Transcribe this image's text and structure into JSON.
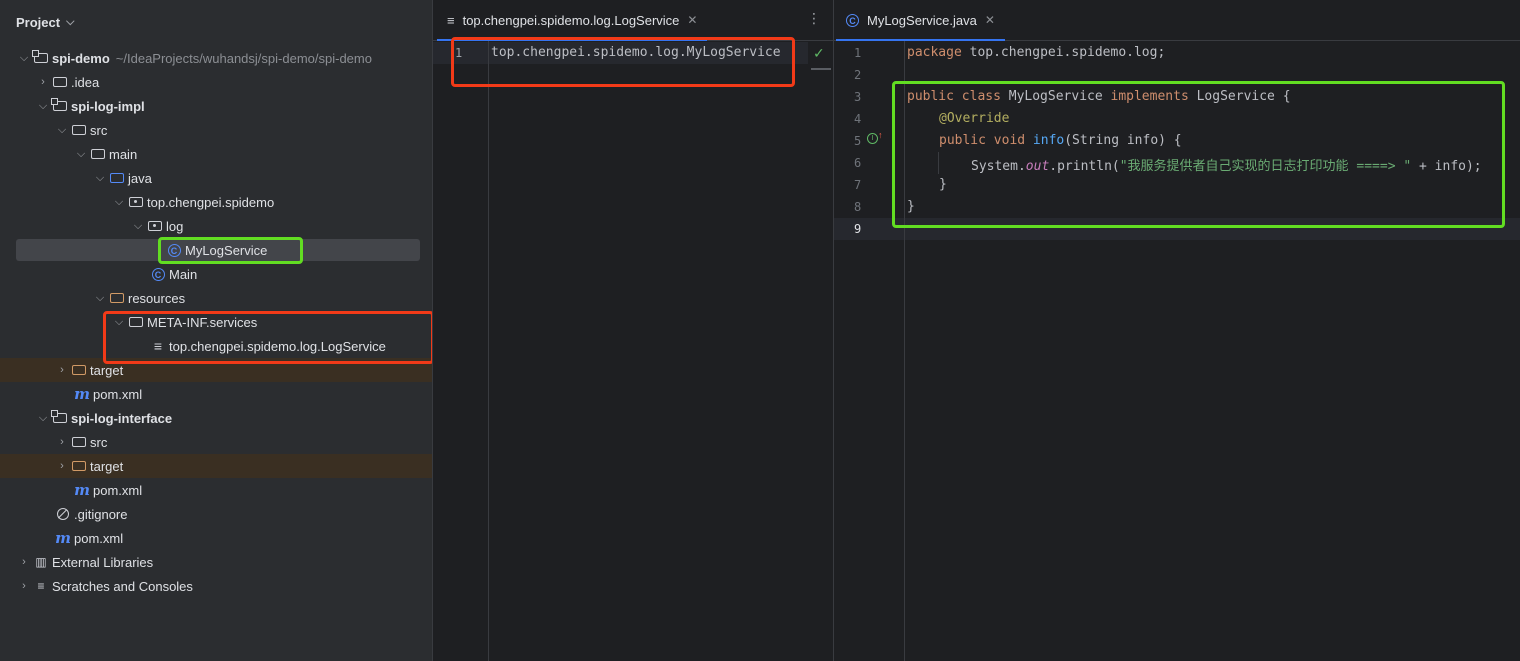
{
  "project_panel": {
    "title": "Project",
    "tree": [
      {
        "label": "spi-demo",
        "hint": "~/IdeaProjects/wuhandsj/spi-demo/spi-demo",
        "icon": "module-folder-icon"
      },
      {
        "label": ".idea",
        "icon": "folder-icon"
      },
      {
        "label": "spi-log-impl",
        "icon": "module-folder-icon"
      },
      {
        "label": "src",
        "icon": "folder-icon"
      },
      {
        "label": "main",
        "icon": "folder-icon"
      },
      {
        "label": "java",
        "icon": "source-folder-icon"
      },
      {
        "label": "top.chengpei.spidemo",
        "icon": "package-icon"
      },
      {
        "label": "log",
        "icon": "package-icon"
      },
      {
        "label": "MyLogService",
        "icon": "class-icon",
        "badge": "C"
      },
      {
        "label": "Main",
        "icon": "class-icon",
        "badge": "C"
      },
      {
        "label": "resources",
        "icon": "resources-folder-icon"
      },
      {
        "label": "META-INF.services",
        "icon": "folder-icon"
      },
      {
        "label": "top.chengpei.spidemo.log.LogService",
        "icon": "text-file-icon"
      },
      {
        "label": "target",
        "icon": "excluded-folder-icon"
      },
      {
        "label": "pom.xml",
        "icon": "maven-icon",
        "glyph": "m"
      },
      {
        "label": "spi-log-interface",
        "icon": "module-folder-icon"
      },
      {
        "label": "src",
        "icon": "folder-icon"
      },
      {
        "label": "target",
        "icon": "excluded-folder-icon"
      },
      {
        "label": "pom.xml",
        "icon": "maven-icon",
        "glyph": "m"
      },
      {
        "label": ".gitignore",
        "icon": "ignore-file-icon"
      },
      {
        "label": "pom.xml",
        "icon": "maven-icon",
        "glyph": "m"
      },
      {
        "label": "External Libraries",
        "icon": "library-icon"
      },
      {
        "label": "Scratches and Consoles",
        "icon": "scratches-icon"
      }
    ]
  },
  "editor_left": {
    "tab_label": "top.chengpei.spidemo.log.LogService",
    "line_numbers": [
      "1"
    ],
    "line1": "top.chengpei.spidemo.log.MyLogService"
  },
  "editor_right": {
    "tab_label": "MyLogService.java",
    "tab_badge": "C",
    "line_numbers": [
      "1",
      "2",
      "3",
      "4",
      "5",
      "6",
      "7",
      "8",
      "9"
    ],
    "code": {
      "l1_kw": "package",
      "l1_rest": " top.chengpei.spidemo.log;",
      "l3_kw1": "public class",
      "l3_name": " MyLogService ",
      "l3_kw2": "implements",
      "l3_rest": " LogService {",
      "l4_ann": "@Override",
      "l5_kw": "public void",
      "l5_fn": " info",
      "l5_rest": "(String info) {",
      "l6_a": "System.",
      "l6_fld": "out",
      "l6_b": ".println(",
      "l6_str": "\"我服务提供者自己实现的日志打印功能 ====> \"",
      "l6_c": " + info);",
      "l7": "}",
      "l8": "}"
    }
  },
  "icons": {
    "chevron_down": "⌄",
    "chevron_right": "›",
    "close": "✕",
    "more": "⋮",
    "check": "✓",
    "lines": "≡"
  }
}
